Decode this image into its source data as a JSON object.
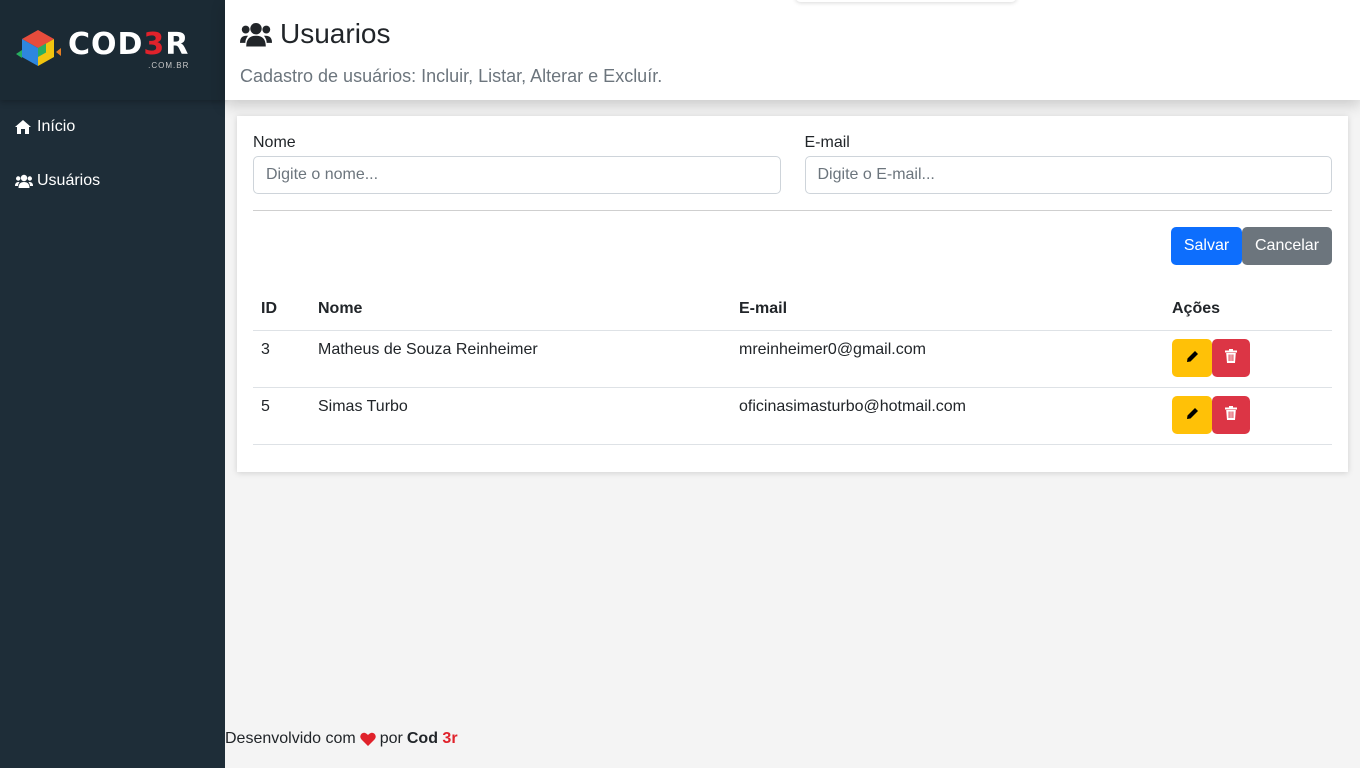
{
  "sidebar": {
    "logo": {
      "text_main": "COD",
      "text_accent": "3",
      "text_end": "R",
      "subtext": ".COM.BR"
    },
    "items": [
      {
        "label": "Início",
        "icon": "home-icon"
      },
      {
        "label": "Usuários",
        "icon": "users-icon"
      }
    ]
  },
  "header": {
    "title": "Usuarios",
    "icon": "users-icon",
    "subtitle": "Cadastro de usuários: Incluir, Listar, Alterar e Excluír."
  },
  "form": {
    "name_label": "Nome",
    "name_placeholder": "Digite o nome...",
    "name_value": "",
    "email_label": "E-mail",
    "email_placeholder": "Digite o E-mail...",
    "email_value": "",
    "save_label": "Salvar",
    "cancel_label": "Cancelar"
  },
  "table": {
    "headers": [
      "ID",
      "Nome",
      "E-mail",
      "Ações"
    ],
    "rows": [
      {
        "id": "3",
        "nome": "Matheus de Souza Reinheimer",
        "email": "mreinheimer0@gmail.com"
      },
      {
        "id": "5",
        "nome": "Simas Turbo",
        "email": "oficinasimasturbo@hotmail.com"
      }
    ]
  },
  "footer": {
    "prefix": "Desenvolvido com",
    "middle": "por",
    "brand_main": "Cod",
    "brand_accent": "3r",
    "heart_icon": "heart-icon"
  },
  "colors": {
    "sidebar_bg": "#1e2d38",
    "primary": "#0d6efd",
    "secondary": "#6c757d",
    "warning": "#ffc107",
    "danger": "#dc3545",
    "accent_red": "#e0222b"
  }
}
